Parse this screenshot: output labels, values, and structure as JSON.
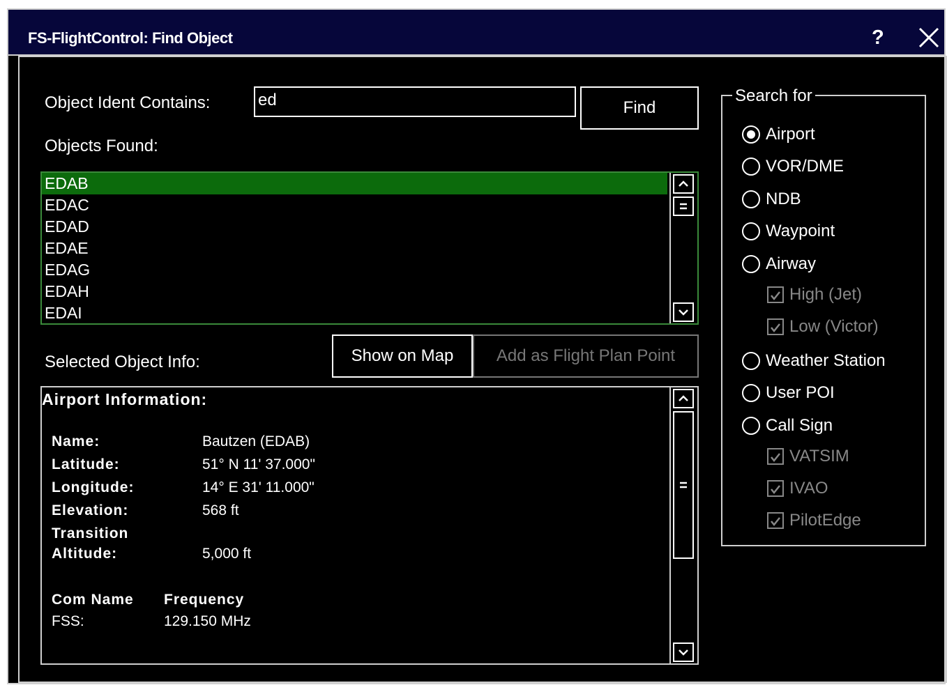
{
  "window": {
    "title": "FS-FlightControl: Find Object",
    "help_label": "?"
  },
  "search": {
    "label": "Object Ident Contains:",
    "value": "ed",
    "find_label": "Find"
  },
  "objects": {
    "label": "Objects Found:",
    "items": [
      "EDAB",
      "EDAC",
      "EDAD",
      "EDAE",
      "EDAG",
      "EDAH",
      "EDAI"
    ],
    "selected": "EDAB"
  },
  "selected_info": {
    "label": "Selected Object Info:",
    "show_on_map": "Show on Map",
    "add_flight_plan": "Add as Flight Plan Point"
  },
  "airport_info": {
    "heading": "Airport Information:",
    "name_label": "Name:",
    "name_value": "Bautzen (EDAB)",
    "lat_label": "Latitude:",
    "lat_value": "51° N 11' 37.000\"",
    "lon_label": "Longitude:",
    "lon_value": "14° E 31' 11.000\"",
    "elev_label": "Elevation:",
    "elev_value": "568 ft",
    "trans_label_1": "Transition",
    "trans_label_2": "Altitude:",
    "trans_value": "5,000 ft",
    "com_header": "Com Name",
    "freq_header": "Frequency",
    "com_name": "FSS:",
    "com_freq": "129.150 MHz"
  },
  "search_for": {
    "legend": "Search for",
    "options": [
      "Airport",
      "VOR/DME",
      "NDB",
      "Waypoint",
      "Airway",
      "Weather Station",
      "User POI",
      "Call Sign"
    ],
    "selected": "Airport",
    "airway_sub": [
      "High (Jet)",
      "Low (Victor)"
    ],
    "callsign_sub": [
      "VATSIM",
      "IVAO",
      "PilotEdge"
    ]
  },
  "colors": {
    "selection": "#0c6b0c",
    "title_bar": "#06063a",
    "disabled": "#777777"
  }
}
